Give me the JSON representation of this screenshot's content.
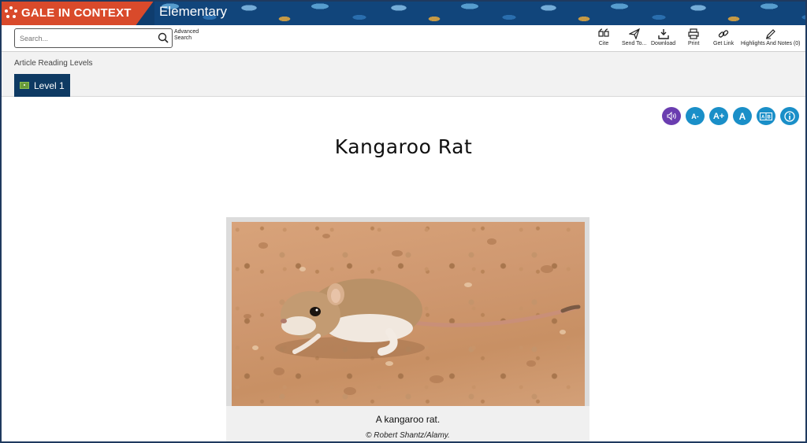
{
  "header": {
    "brand": "GALE IN CONTEXT",
    "edition": "Elementary"
  },
  "search": {
    "placeholder": "Search...",
    "advanced_line1": "Advanced",
    "advanced_line2": "Search"
  },
  "toolbar": {
    "items": [
      {
        "label": "Cite",
        "icon": "quote-icon"
      },
      {
        "label": "Send To...",
        "icon": "send-icon"
      },
      {
        "label": "Download",
        "icon": "download-icon"
      },
      {
        "label": "Print",
        "icon": "print-icon"
      },
      {
        "label": "Get Link",
        "icon": "link-icon"
      },
      {
        "label": "Highlights And Notes (0)",
        "icon": "pencil-icon"
      }
    ]
  },
  "reading_levels": {
    "label": "Article Reading Levels",
    "active_level": "Level 1"
  },
  "article_tools": {
    "listen": "listen",
    "font_decrease": "A-",
    "font_increase": "A+",
    "font_style": "A",
    "translate": "A|B",
    "info": "i"
  },
  "article": {
    "title": "Kangaroo Rat",
    "image_caption": "A kangaroo rat.",
    "image_credit": "© Robert Shantz/Alamy."
  },
  "colors": {
    "banner": "#0f3d6e",
    "brand": "#d94a2b",
    "level_tab": "#0e3a63",
    "tool_button": "#1a8fc8",
    "listen_button": "#6a3db0"
  }
}
